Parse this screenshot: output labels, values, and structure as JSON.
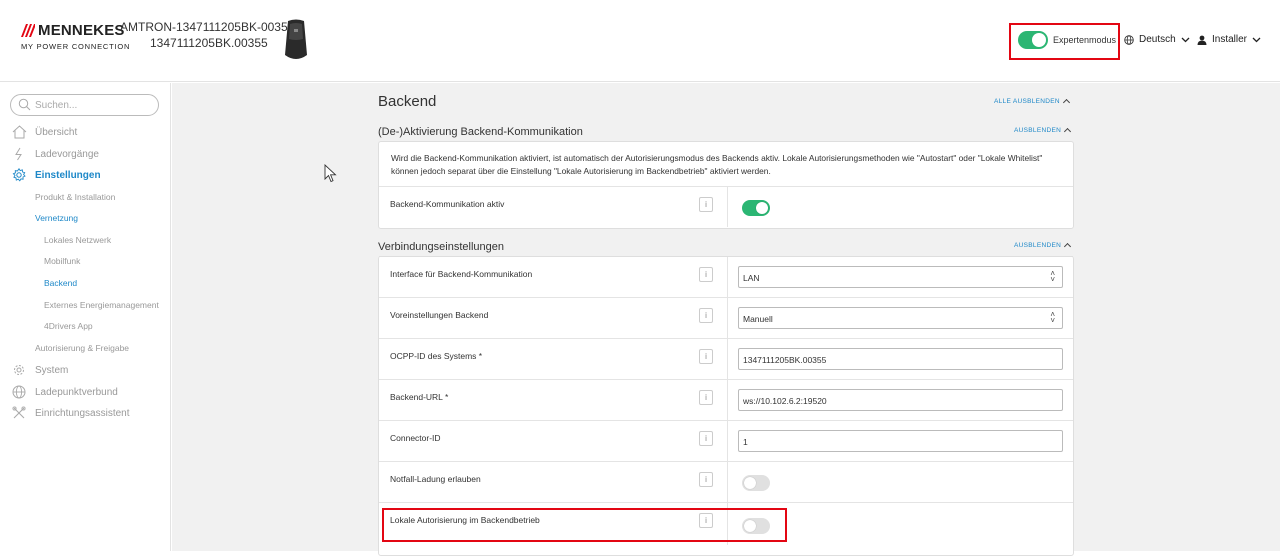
{
  "header": {
    "brand": "MENNEKES",
    "tagline": "MY POWER CONNECTION",
    "device_name": "AMTRON-1347111205BK-00355",
    "device_serial": "1347111205BK.00355",
    "expert_mode_label": "Expertenmodus",
    "expert_mode_on": true,
    "language": "Deutsch",
    "user": "Installer"
  },
  "sidebar": {
    "search_placeholder": "Suchen...",
    "items": [
      {
        "label": "Übersicht",
        "icon": "home-icon"
      },
      {
        "label": "Ladevorgänge",
        "icon": "lightning-icon"
      },
      {
        "label": "Einstellungen",
        "icon": "gear-icon",
        "active": true
      },
      {
        "label": "System",
        "icon": "system-icon"
      },
      {
        "label": "Ladepunktverbund",
        "icon": "globe-icon"
      },
      {
        "label": "Einrichtungsassistent",
        "icon": "tools-icon"
      }
    ],
    "sub_items": [
      {
        "label": "Produkt & Installation"
      },
      {
        "label": "Vernetzung",
        "active": true
      },
      {
        "label": "Lokales Netzwerk"
      },
      {
        "label": "Mobilfunk"
      },
      {
        "label": "Backend",
        "active": true
      },
      {
        "label": "Externes Energiemanagement"
      },
      {
        "label": "4Drivers App"
      },
      {
        "label": "Autorisierung & Freigabe"
      }
    ]
  },
  "main": {
    "title": "Backend",
    "collapse_all": "ALLE AUSBLENDEN",
    "collapse": "AUSBLENDEN",
    "section1": {
      "title": "(De-)Aktivierung Backend-Kommunikation",
      "info": "Wird die Backend-Kommunikation aktiviert, ist automatisch der Autorisierungsmodus des Backends aktiv. Lokale Autorisierungsmethoden wie \"Autostart\" oder \"Lokale Whitelist\" können jedoch separat über die Einstellung \"Lokale Autorisierung im Backendbetrieb\" aktiviert werden.",
      "row_label": "Backend-Kommunikation aktiv",
      "toggle_on": true
    },
    "section2": {
      "title": "Verbindungseinstellungen",
      "rows": [
        {
          "label": "Interface für Backend-Kommunikation",
          "value": "LAN"
        },
        {
          "label": "Voreinstellungen Backend",
          "value": "Manuell"
        },
        {
          "label": "OCPP-ID des Systems *",
          "value": "1347111205BK.00355"
        },
        {
          "label": "Backend-URL *",
          "value": "ws://10.102.6.2:19520"
        },
        {
          "label": "Connector-ID",
          "value": "1"
        },
        {
          "label": "Notfall-Ladung erlauben",
          "toggle_on": false
        },
        {
          "label": "Lokale Autorisierung im Backendbetrieb",
          "toggle_on": false
        }
      ]
    },
    "info_glyph": "i"
  },
  "colors": {
    "accent": "#1e88c8",
    "toggle_on": "#2bb673",
    "highlight": "#e30613"
  }
}
